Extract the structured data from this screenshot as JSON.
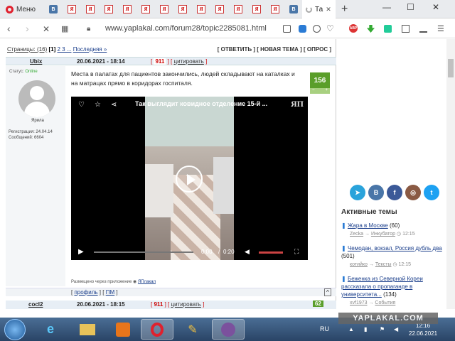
{
  "browser": {
    "menu_label": "Меню",
    "active_tab_label": "Та",
    "url": "www.yaplakal.com/forum28/topic2285081.html",
    "abp_label": "ABP"
  },
  "forum": {
    "pager_prefix": "Страницы: (16)",
    "pager_current": "[1]",
    "pager_pages": "2 3 ...",
    "pager_last": "Последняя »",
    "actions": "[ ОТВЕТИТЬ ] [ НОВАЯ ТЕМА ] [ ОПРОС ]"
  },
  "post": {
    "author": "Ubix",
    "date": "20.06.2021 - 18:14",
    "number": "911",
    "cite": "цитировать",
    "status_label": "Статус:",
    "status_value": "Online",
    "nick": "Ярила",
    "reg_label": "Регистрация:",
    "reg_date": "24.04.14",
    "msgs_label": "Сообщений:",
    "msgs_count": "6604",
    "text": "Места в палатах для пациентов закончились, людей складывают на каталках и на матрацах прямо в коридорах госпиталя.",
    "rating": "156",
    "rating_minus": "−",
    "rating_plus": "+",
    "video_title": "Так выглядит ковидное отделение 15-й ...",
    "video_logo": "ЯП",
    "video_time": "0:00",
    "video_sep": "/",
    "video_duration": "0:20",
    "app_note": "Размещено через приложение",
    "app_link": "ЯПлакал",
    "profile_link": "профиль",
    "pm_link": "ПМ",
    "up_icon": "^"
  },
  "post2": {
    "author": "cocl2",
    "date": "20.06.2021 - 18:15",
    "number": "911",
    "cite": "цитировать",
    "rating": "62"
  },
  "sidebar": {
    "active_title": "Активные темы",
    "topics": [
      {
        "title": "Жара в Москве",
        "count": "(60)",
        "user": "Zecka",
        "section": "Инкубатор",
        "time": "12:15"
      },
      {
        "title": "Чемодан, вокзал, Россия дубль два",
        "count": "(501)",
        "user": "котийко",
        "section": "Тексты",
        "time": "12:15"
      },
      {
        "title": "Беженка из Северной Кореи рассказала о пропаганде в университета...",
        "count": "(134)",
        "user": "xvf1973",
        "section": "События",
        "time": "12:15"
      }
    ]
  },
  "watermark": "YAPLAKAL.COM",
  "taskbar": {
    "lang": "RU",
    "time": "12:16",
    "date": "22.06.2021"
  }
}
